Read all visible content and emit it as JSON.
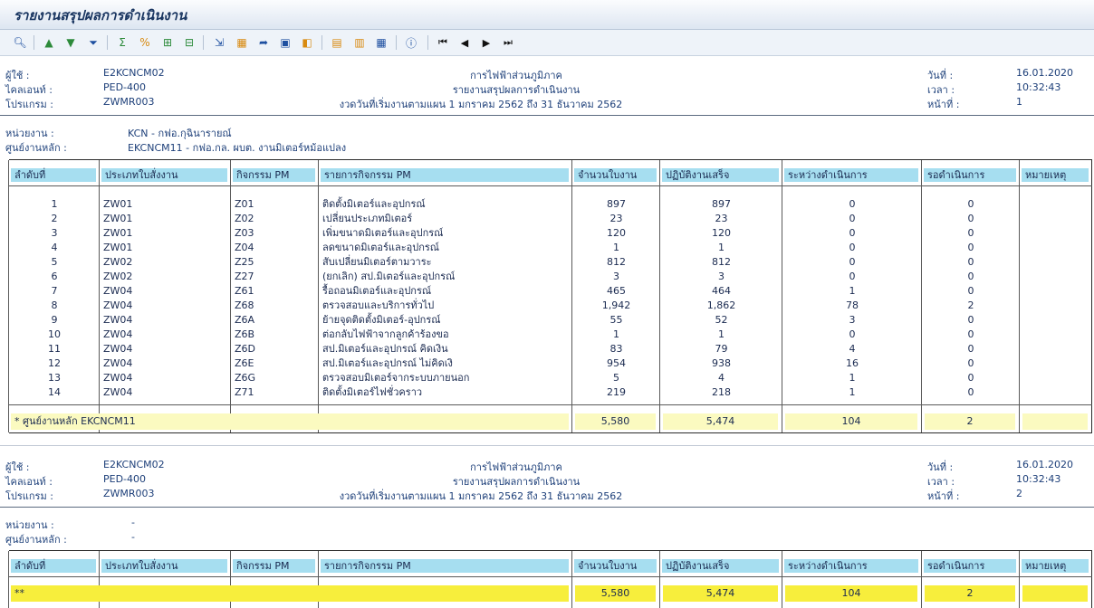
{
  "window": {
    "title": "รายงานสรุปผลการดำเนินงาน"
  },
  "toolbar": {
    "icons": [
      "detail-icon",
      "sort-ascending-icon",
      "sort-descending-icon",
      "filter-icon",
      "sum-icon",
      "subtotal-icon",
      "expand-icon",
      "collapse-icon",
      "export-icon",
      "spreadsheet-icon",
      "send-icon",
      "print-preview-icon",
      "graphic-icon",
      "change-layout-icon",
      "select-layout-icon",
      "save-layout-icon",
      "info-icon",
      "first-page-icon",
      "previous-page-icon",
      "next-page-icon",
      "last-page-icon"
    ]
  },
  "labels": {
    "user": "ผู้ใช้ :",
    "client": "ไคลเอนท์ :",
    "program": "โปรแกรม :",
    "date": "วันที่ :",
    "time": "เวลา :",
    "page": "หน้าที่ :",
    "unit": "หน่วยงาน :",
    "center": "ศูนย์งานหลัก :"
  },
  "page1": {
    "user": "E2KCNCM02",
    "client": "PED-400",
    "program": "ZWMR003",
    "org": "การไฟฟ้าส่วนภูมิภาค",
    "report": "รายงานสรุปผลการดำเนินงาน",
    "period": "งวดวันที่เริ่มงานตามแผน 1 มกราคม 2562 ถึง 31 ธันวาคม 2562",
    "date": "16.01.2020",
    "time": "10:32:43",
    "page": "1",
    "unit": "KCN - กฟอ.กุฉินารายณ์",
    "center": "EKCNCM11 - กฟอ.กล. ผบต. งานมิเตอร์หม้อแปลง"
  },
  "page2": {
    "user": "E2KCNCM02",
    "client": "PED-400",
    "program": "ZWMR003",
    "org": "การไฟฟ้าส่วนภูมิภาค",
    "report": "รายงานสรุปผลการดำเนินงาน",
    "period": "งวดวันที่เริ่มงานตามแผน 1 มกราคม 2562 ถึง 31 ธันวาคม 2562",
    "date": "16.01.2020",
    "time": "10:32:43",
    "page": "2",
    "unit": "-",
    "center": "-"
  },
  "table": {
    "headers": [
      "ลำดับที่",
      "ประเภทใบสั่งงาน",
      "กิจกรรม PM",
      "รายการกิจกรรม PM",
      "จำนวนใบงาน",
      "ปฏิบัติงานเสร็จ",
      "ระหว่างดำเนินการ",
      "รอดำเนินการ",
      "หมายเหตุ"
    ],
    "rows": [
      [
        "1",
        "ZW01",
        "Z01",
        "ติดตั้งมิเตอร์และอุปกรณ์",
        "897",
        "897",
        "0",
        "0"
      ],
      [
        "2",
        "ZW01",
        "Z02",
        "เปลี่ยนประเภทมิเตอร์",
        "23",
        "23",
        "0",
        "0"
      ],
      [
        "3",
        "ZW01",
        "Z03",
        "เพิ่มขนาดมิเตอร์และอุปกรณ์",
        "120",
        "120",
        "0",
        "0"
      ],
      [
        "4",
        "ZW01",
        "Z04",
        "ลดขนาดมิเตอร์และอุปกรณ์",
        "1",
        "1",
        "0",
        "0"
      ],
      [
        "5",
        "ZW02",
        "Z25",
        "สับเปลี่ยนมิเตอร์ตามวาระ",
        "812",
        "812",
        "0",
        "0"
      ],
      [
        "6",
        "ZW02",
        "Z27",
        "(ยกเลิก) สป.มิเตอร์และอุปกรณ์",
        "3",
        "3",
        "0",
        "0"
      ],
      [
        "7",
        "ZW04",
        "Z61",
        "รื้อถอนมิเตอร์และอุปกรณ์",
        "465",
        "464",
        "1",
        "0"
      ],
      [
        "8",
        "ZW04",
        "Z68",
        "ตรวจสอบและบริการทั่วไป",
        "1,942",
        "1,862",
        "78",
        "2"
      ],
      [
        "9",
        "ZW04",
        "Z6A",
        "ย้ายจุดติดตั้งมิเตอร์-อุปกรณ์",
        "55",
        "52",
        "3",
        "0"
      ],
      [
        "10",
        "ZW04",
        "Z6B",
        "ต่อกลับไฟฟ้าจากลูกค้าร้องขอ",
        "1",
        "1",
        "0",
        "0"
      ],
      [
        "11",
        "ZW04",
        "Z6D",
        "สป.มิเตอร์และอุปกรณ์ คิดเงิน",
        "83",
        "79",
        "4",
        "0"
      ],
      [
        "12",
        "ZW04",
        "Z6E",
        "สป.มิเตอร์และอุปกรณ์ ไม่คิดเงิ",
        "954",
        "938",
        "16",
        "0"
      ],
      [
        "13",
        "ZW04",
        "Z6G",
        "ตรวจสอบมิเตอร์จากระบบภายนอก",
        "5",
        "4",
        "1",
        "0"
      ],
      [
        "14",
        "ZW04",
        "Z71",
        "ติดตั้งมิเตอร์ไฟชั่วคราว",
        "219",
        "218",
        "1",
        "0"
      ]
    ],
    "subtotal": {
      "label": "*  ศูนย์งานหลัก EKCNCM11",
      "orders": "5,580",
      "done": "5,474",
      "in_progress": "104",
      "waiting": "2"
    },
    "total": {
      "label": "**",
      "orders": "5,580",
      "done": "5,474",
      "in_progress": "104",
      "waiting": "2"
    }
  }
}
